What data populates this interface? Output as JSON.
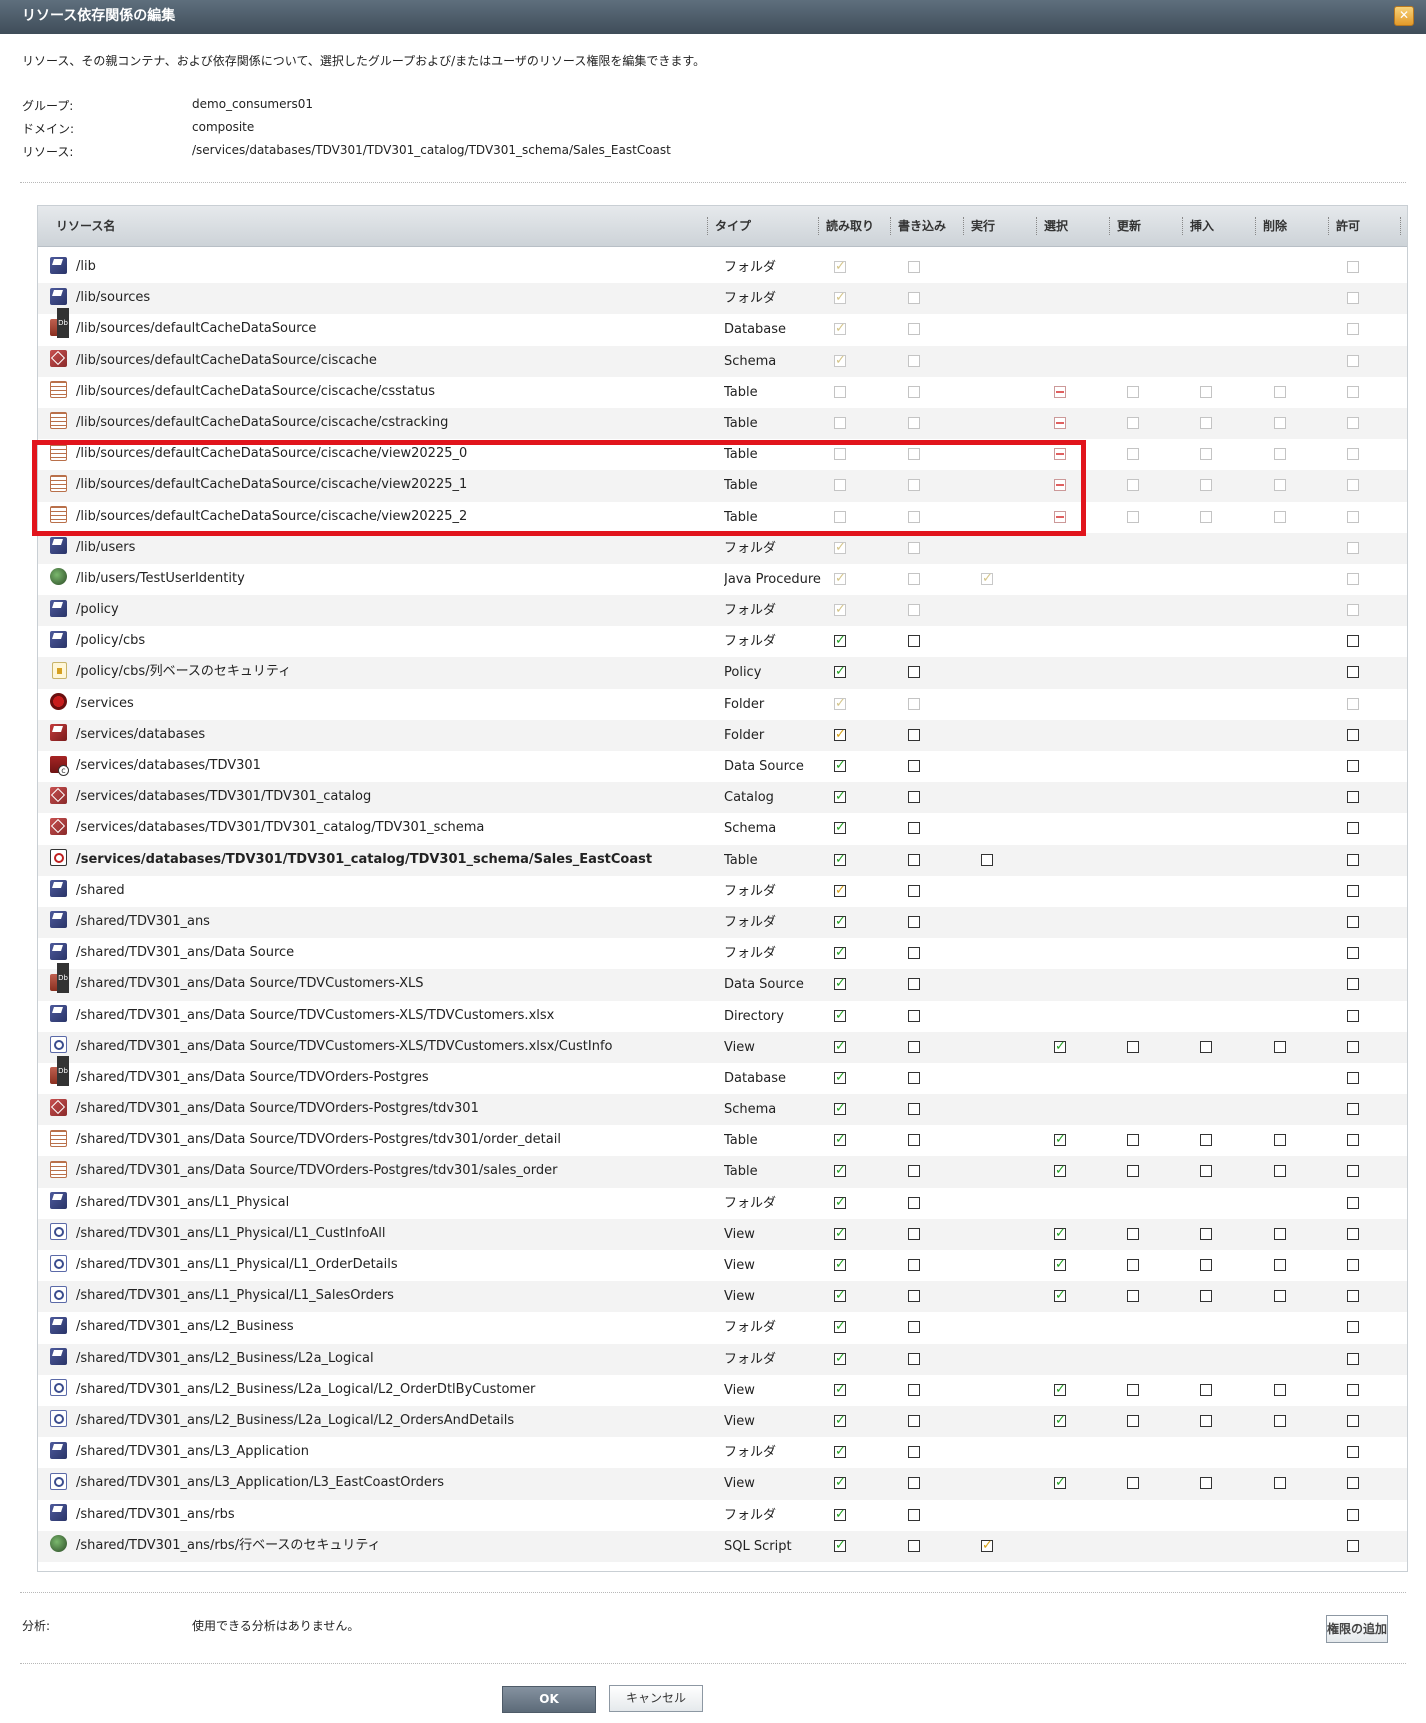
{
  "dialog": {
    "title": "リソース依存関係の編集",
    "description": "リソース、その親コンテナ、および依存関係について、選択したグループおよび/またはユーザのリソース権限を編集できます。",
    "group_label": "グループ:",
    "group_value": "demo_consumers01",
    "domain_label": "ドメイン:",
    "domain_value": "composite",
    "resource_label": "リソース:",
    "resource_value": "/services/databases/TDV301/TDV301_catalog/TDV301_schema/Sales_EastCoast",
    "analysis_label": "分析:",
    "analysis_value": "使用できる分析はありません。",
    "add_permission_button": "権限の追加",
    "ok_button": "OK",
    "cancel_button": "キャンセル"
  },
  "table": {
    "columns": [
      "リソース名",
      "タイプ",
      "読み取り",
      "書き込み",
      "実行",
      "選択",
      "更新",
      "挿入",
      "削除",
      "許可"
    ],
    "permission_columns": [
      "read",
      "write",
      "exec",
      "select",
      "update",
      "insert",
      "delete",
      "grant"
    ],
    "legend": {
      "0": "none",
      "d": "disabled-empty",
      "c": "checked",
      "g": "checked-disabled",
      "y": "checked-partial",
      "p": "partial-indeterminate",
      "e": "empty"
    },
    "rows": [
      {
        "name": "/lib",
        "type": "フォルダ",
        "icon": "folder-icon",
        "perms": [
          "g",
          "d",
          "0",
          "0",
          "0",
          "0",
          "0",
          "d"
        ]
      },
      {
        "name": "/lib/sources",
        "type": "フォルダ",
        "icon": "folder-icon",
        "perms": [
          "g",
          "d",
          "0",
          "0",
          "0",
          "0",
          "0",
          "d"
        ]
      },
      {
        "name": "/lib/sources/defaultCacheDataSource",
        "type": "Database",
        "icon": "database-icon",
        "perms": [
          "g",
          "d",
          "0",
          "0",
          "0",
          "0",
          "0",
          "d"
        ]
      },
      {
        "name": "/lib/sources/defaultCacheDataSource/ciscache",
        "type": "Schema",
        "icon": "schema-icon",
        "perms": [
          "g",
          "d",
          "0",
          "0",
          "0",
          "0",
          "0",
          "d"
        ]
      },
      {
        "name": "/lib/sources/defaultCacheDataSource/ciscache/csstatus",
        "type": "Table",
        "icon": "table-icon",
        "perms": [
          "d",
          "d",
          "0",
          "p",
          "d",
          "d",
          "d",
          "d"
        ]
      },
      {
        "name": "/lib/sources/defaultCacheDataSource/ciscache/cstracking",
        "type": "Table",
        "icon": "table-icon",
        "perms": [
          "d",
          "d",
          "0",
          "p",
          "d",
          "d",
          "d",
          "d"
        ]
      },
      {
        "name": "/lib/sources/defaultCacheDataSource/ciscache/view20225_0",
        "type": "Table",
        "icon": "table-icon",
        "perms": [
          "d",
          "d",
          "0",
          "p",
          "d",
          "d",
          "d",
          "d"
        ]
      },
      {
        "name": "/lib/sources/defaultCacheDataSource/ciscache/view20225_1",
        "type": "Table",
        "icon": "table-icon",
        "perms": [
          "d",
          "d",
          "0",
          "p",
          "d",
          "d",
          "d",
          "d"
        ]
      },
      {
        "name": "/lib/sources/defaultCacheDataSource/ciscache/view20225_2",
        "type": "Table",
        "icon": "table-icon",
        "perms": [
          "d",
          "d",
          "0",
          "p",
          "d",
          "d",
          "d",
          "d"
        ]
      },
      {
        "name": "/lib/users",
        "type": "フォルダ",
        "icon": "folder-icon",
        "perms": [
          "g",
          "d",
          "0",
          "0",
          "0",
          "0",
          "0",
          "d"
        ]
      },
      {
        "name": "/lib/users/TestUserIdentity",
        "type": "Java Procedure",
        "icon": "procedure-icon",
        "perms": [
          "g",
          "d",
          "g",
          "0",
          "0",
          "0",
          "0",
          "d"
        ]
      },
      {
        "name": "/policy",
        "type": "フォルダ",
        "icon": "folder-icon",
        "perms": [
          "g",
          "d",
          "0",
          "0",
          "0",
          "0",
          "0",
          "d"
        ]
      },
      {
        "name": "/policy/cbs",
        "type": "フォルダ",
        "icon": "folder-icon",
        "perms": [
          "c",
          "e",
          "0",
          "0",
          "0",
          "0",
          "0",
          "e"
        ]
      },
      {
        "name": "/policy/cbs/列ベースのセキュリティ",
        "type": "Policy",
        "icon": "policy-icon",
        "perms": [
          "c",
          "e",
          "0",
          "0",
          "0",
          "0",
          "0",
          "e"
        ]
      },
      {
        "name": "/services",
        "type": "Folder",
        "icon": "services-root-icon",
        "perms": [
          "g",
          "d",
          "0",
          "0",
          "0",
          "0",
          "0",
          "d"
        ]
      },
      {
        "name": "/services/databases",
        "type": "Folder",
        "icon": "folder-red-icon",
        "perms": [
          "y",
          "e",
          "0",
          "0",
          "0",
          "0",
          "0",
          "e"
        ]
      },
      {
        "name": "/services/databases/TDV301",
        "type": "Data Source",
        "icon": "datasource-icon",
        "perms": [
          "c",
          "e",
          "0",
          "0",
          "0",
          "0",
          "0",
          "e"
        ]
      },
      {
        "name": "/services/databases/TDV301/TDV301_catalog",
        "type": "Catalog",
        "icon": "schema-icon",
        "perms": [
          "c",
          "e",
          "0",
          "0",
          "0",
          "0",
          "0",
          "e"
        ]
      },
      {
        "name": "/services/databases/TDV301/TDV301_catalog/TDV301_schema",
        "type": "Schema",
        "icon": "schema-icon",
        "perms": [
          "c",
          "e",
          "0",
          "0",
          "0",
          "0",
          "0",
          "e"
        ]
      },
      {
        "name": "/services/databases/TDV301/TDV301_catalog/TDV301_schema/Sales_EastCoast",
        "type": "Table",
        "icon": "selected-view-icon",
        "bold": true,
        "perms": [
          "c",
          "e",
          "e",
          "0",
          "0",
          "0",
          "0",
          "e"
        ]
      },
      {
        "name": "/shared",
        "type": "フォルダ",
        "icon": "folder-icon",
        "perms": [
          "y",
          "e",
          "0",
          "0",
          "0",
          "0",
          "0",
          "e"
        ]
      },
      {
        "name": "/shared/TDV301_ans",
        "type": "フォルダ",
        "icon": "folder-icon",
        "perms": [
          "c",
          "e",
          "0",
          "0",
          "0",
          "0",
          "0",
          "e"
        ]
      },
      {
        "name": "/shared/TDV301_ans/Data Source",
        "type": "フォルダ",
        "icon": "folder-icon",
        "perms": [
          "c",
          "e",
          "0",
          "0",
          "0",
          "0",
          "0",
          "e"
        ]
      },
      {
        "name": "/shared/TDV301_ans/Data Source/TDVCustomers-XLS",
        "type": "Data Source",
        "icon": "database-icon",
        "perms": [
          "c",
          "e",
          "0",
          "0",
          "0",
          "0",
          "0",
          "e"
        ]
      },
      {
        "name": "/shared/TDV301_ans/Data Source/TDVCustomers-XLS/TDVCustomers.xlsx",
        "type": "Directory",
        "icon": "folder-icon",
        "perms": [
          "c",
          "e",
          "0",
          "0",
          "0",
          "0",
          "0",
          "e"
        ]
      },
      {
        "name": "/shared/TDV301_ans/Data Source/TDVCustomers-XLS/TDVCustomers.xlsx/CustInfo",
        "type": "View",
        "icon": "view-icon",
        "perms": [
          "c",
          "e",
          "0",
          "c",
          "e",
          "e",
          "e",
          "e"
        ]
      },
      {
        "name": "/shared/TDV301_ans/Data Source/TDVOrders-Postgres",
        "type": "Database",
        "icon": "database-icon",
        "perms": [
          "c",
          "e",
          "0",
          "0",
          "0",
          "0",
          "0",
          "e"
        ]
      },
      {
        "name": "/shared/TDV301_ans/Data Source/TDVOrders-Postgres/tdv301",
        "type": "Schema",
        "icon": "schema-icon",
        "perms": [
          "c",
          "e",
          "0",
          "0",
          "0",
          "0",
          "0",
          "e"
        ]
      },
      {
        "name": "/shared/TDV301_ans/Data Source/TDVOrders-Postgres/tdv301/order_detail",
        "type": "Table",
        "icon": "table-icon",
        "perms": [
          "c",
          "e",
          "0",
          "c",
          "e",
          "e",
          "e",
          "e"
        ]
      },
      {
        "name": "/shared/TDV301_ans/Data Source/TDVOrders-Postgres/tdv301/sales_order",
        "type": "Table",
        "icon": "table-icon",
        "perms": [
          "c",
          "e",
          "0",
          "c",
          "e",
          "e",
          "e",
          "e"
        ]
      },
      {
        "name": "/shared/TDV301_ans/L1_Physical",
        "type": "フォルダ",
        "icon": "folder-icon",
        "perms": [
          "c",
          "e",
          "0",
          "0",
          "0",
          "0",
          "0",
          "e"
        ]
      },
      {
        "name": "/shared/TDV301_ans/L1_Physical/L1_CustInfoAll",
        "type": "View",
        "icon": "view-icon",
        "perms": [
          "c",
          "e",
          "0",
          "c",
          "e",
          "e",
          "e",
          "e"
        ]
      },
      {
        "name": "/shared/TDV301_ans/L1_Physical/L1_OrderDetails",
        "type": "View",
        "icon": "view-icon",
        "perms": [
          "c",
          "e",
          "0",
          "c",
          "e",
          "e",
          "e",
          "e"
        ]
      },
      {
        "name": "/shared/TDV301_ans/L1_Physical/L1_SalesOrders",
        "type": "View",
        "icon": "view-icon",
        "perms": [
          "c",
          "e",
          "0",
          "c",
          "e",
          "e",
          "e",
          "e"
        ]
      },
      {
        "name": "/shared/TDV301_ans/L2_Business",
        "type": "フォルダ",
        "icon": "folder-icon",
        "perms": [
          "c",
          "e",
          "0",
          "0",
          "0",
          "0",
          "0",
          "e"
        ]
      },
      {
        "name": "/shared/TDV301_ans/L2_Business/L2a_Logical",
        "type": "フォルダ",
        "icon": "folder-icon",
        "perms": [
          "c",
          "e",
          "0",
          "0",
          "0",
          "0",
          "0",
          "e"
        ]
      },
      {
        "name": "/shared/TDV301_ans/L2_Business/L2a_Logical/L2_OrderDtlByCustomer",
        "type": "View",
        "icon": "view-icon",
        "perms": [
          "c",
          "e",
          "0",
          "c",
          "e",
          "e",
          "e",
          "e"
        ]
      },
      {
        "name": "/shared/TDV301_ans/L2_Business/L2a_Logical/L2_OrdersAndDetails",
        "type": "View",
        "icon": "view-icon",
        "perms": [
          "c",
          "e",
          "0",
          "c",
          "e",
          "e",
          "e",
          "e"
        ]
      },
      {
        "name": "/shared/TDV301_ans/L3_Application",
        "type": "フォルダ",
        "icon": "folder-icon",
        "perms": [
          "c",
          "e",
          "0",
          "0",
          "0",
          "0",
          "0",
          "e"
        ]
      },
      {
        "name": "/shared/TDV301_ans/L3_Application/L3_EastCoastOrders",
        "type": "View",
        "icon": "view-icon",
        "perms": [
          "c",
          "e",
          "0",
          "c",
          "e",
          "e",
          "e",
          "e"
        ]
      },
      {
        "name": "/shared/TDV301_ans/rbs",
        "type": "フォルダ",
        "icon": "folder-icon",
        "perms": [
          "c",
          "e",
          "0",
          "0",
          "0",
          "0",
          "0",
          "e"
        ]
      },
      {
        "name": "/shared/TDV301_ans/rbs/行ベースのセキュリティ",
        "type": "SQL Script",
        "icon": "procedure-icon",
        "perms": [
          "c",
          "e",
          "y",
          "0",
          "0",
          "0",
          "0",
          "e"
        ]
      }
    ]
  }
}
